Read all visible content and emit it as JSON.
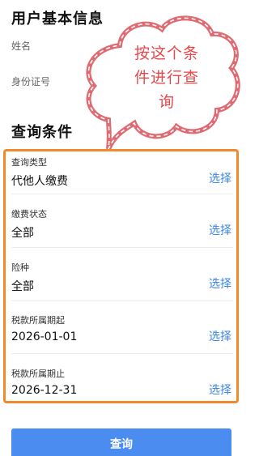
{
  "user_info": {
    "title": "用户基本信息",
    "name_label": "姓名",
    "id_label": "身份证号"
  },
  "callout": {
    "line1": "按这个条",
    "line2": "件进行查",
    "line3": "询"
  },
  "query_conditions": {
    "title": "查询条件",
    "rows": [
      {
        "label": "查询类型",
        "value": "代他人缴费",
        "action": "选择"
      },
      {
        "label": "缴费状态",
        "value": "全部",
        "action": "选择"
      },
      {
        "label": "险种",
        "value": "全部",
        "action": "选择"
      },
      {
        "label": "税款所属期起",
        "value": "2026-01-01",
        "action": "选择"
      },
      {
        "label": "税款所属期止",
        "value": "2026-12-31",
        "action": "选择"
      }
    ]
  },
  "query_button": "查询",
  "colors": {
    "highlight_border": "#f28a2c",
    "callout_text": "#e8474b",
    "link": "#3d86e6",
    "button": "#4a8cf0"
  }
}
